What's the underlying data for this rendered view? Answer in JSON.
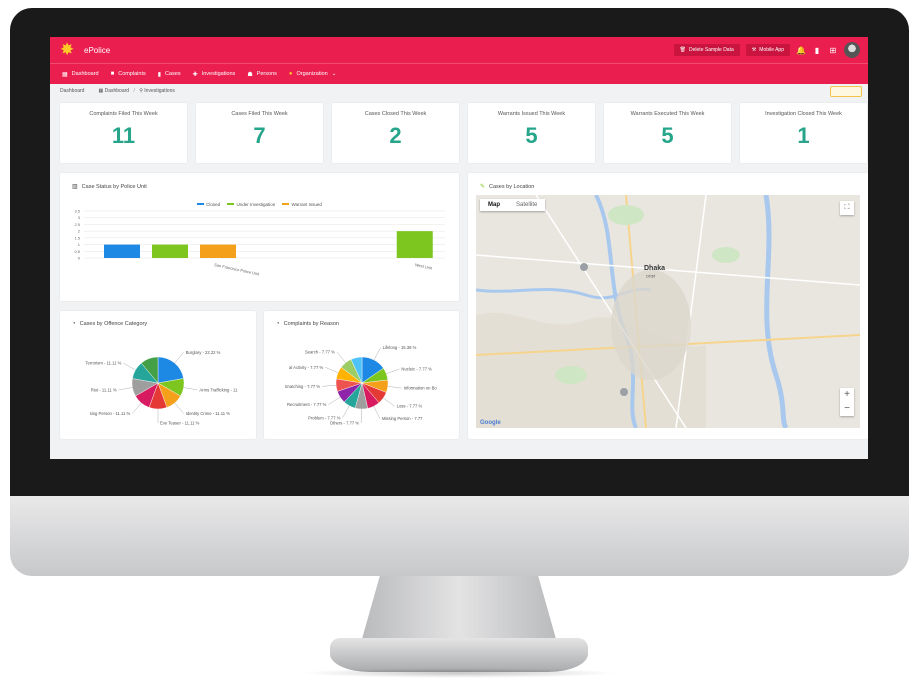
{
  "app": {
    "name": "ePolice"
  },
  "topbar": {
    "delete_sample_label": "Delete Sample Data",
    "mobile_app_label": "Mobile App"
  },
  "nav": {
    "items": [
      {
        "label": "Dashboard",
        "icon": "grid-icon"
      },
      {
        "label": "Complaints",
        "icon": "chat-icon"
      },
      {
        "label": "Cases",
        "icon": "folder-icon"
      },
      {
        "label": "Investigations",
        "icon": "wrench-icon"
      },
      {
        "label": "Persons",
        "icon": "users-icon"
      },
      {
        "label": "Organization",
        "icon": "org-icon"
      }
    ]
  },
  "breadcrumb": {
    "current": "Dashboard",
    "items": [
      "Dashboard",
      "Investigations"
    ]
  },
  "stats": [
    {
      "title": "Complaints Filed This Week",
      "value": "11"
    },
    {
      "title": "Cases Filed This Week",
      "value": "7"
    },
    {
      "title": "Cases Closed This Week",
      "value": "2"
    },
    {
      "title": "Warrants Issued This Week",
      "value": "5"
    },
    {
      "title": "Warrants Executed This Week",
      "value": "5"
    },
    {
      "title": "Investigation Closed This Week",
      "value": "1"
    }
  ],
  "panels": {
    "case_status_title": "Case Status by Police Unit",
    "location_title": "Cases by Location",
    "offence_title": "Cases by Offence Category",
    "complaints_title": "Complaints by Reason"
  },
  "map": {
    "tab_map": "Map",
    "tab_satellite": "Satellite",
    "city": "Dhaka",
    "city_local": "ঢাকা",
    "google": "Google"
  },
  "colors": {
    "brand": "#ea1e4f",
    "stat_value": "#27a58b",
    "closed": "#1e88e5",
    "under_investigation": "#7cc61f",
    "warrant_issued": "#f5a01b"
  },
  "chart_data": [
    {
      "type": "bar",
      "title": "Case Status by Police Unit",
      "categories": [
        "San Francisco Police Unit",
        "West Unit"
      ],
      "series": [
        {
          "name": "Closed",
          "values": [
            1,
            0
          ]
        },
        {
          "name": "Under Investigation",
          "values": [
            1,
            2
          ]
        },
        {
          "name": "Warrant Issued",
          "values": [
            1,
            0
          ]
        }
      ],
      "y_ticks": [
        "3.5",
        "3",
        "2.5",
        "2",
        "1.5",
        "1",
        "0.5",
        "0"
      ],
      "ylim": [
        0,
        3.5
      ],
      "legend": "top"
    },
    {
      "type": "pie",
      "title": "Cases by Offence Category",
      "slices": [
        {
          "label": "Burglary",
          "value": 22.22,
          "text": "Burglary - 22.22 %",
          "color": "#1e88e5"
        },
        {
          "label": "Arms Trafficking",
          "value": 11.11,
          "text": "Arms Trafficking - 11",
          "color": "#7cc61f"
        },
        {
          "label": "Identity Crime",
          "value": 11.11,
          "text": "Identity Crime - 11.11 %",
          "color": "#f5a01b"
        },
        {
          "label": "Eve Teaser",
          "value": 11.11,
          "text": "Eve Teaser - 11.11 %",
          "color": "#e53935"
        },
        {
          "label": "Missing Person",
          "value": 11.11,
          "text": "sing Person - 11.11 %",
          "color": "#d81b60"
        },
        {
          "label": "Riot",
          "value": 11.11,
          "text": "Riot - 11.11 %",
          "color": "#9e9e9e"
        },
        {
          "label": "Terrorism",
          "value": 11.11,
          "text": "Terrorism - 11.11 %",
          "color": "#26a69a"
        },
        {
          "label": "Other",
          "value": 11.12,
          "text": "",
          "color": "#43a047"
        }
      ]
    },
    {
      "type": "pie",
      "title": "Complaints by Reason",
      "slices": [
        {
          "label": "Lifelong",
          "value": 15.38,
          "text": "Lifelong - 15.38 %",
          "color": "#1e88e5"
        },
        {
          "label": "Nucleic",
          "value": 7.77,
          "text": "Nucleic - 7.77 %",
          "color": "#7cc61f"
        },
        {
          "label": "Information on Bo",
          "value": 7.77,
          "text": "Information on Bo",
          "color": "#f5a01b"
        },
        {
          "label": "Loss",
          "value": 7.77,
          "text": "Loss - 7.77 %",
          "color": "#e53935"
        },
        {
          "label": "Missing Person",
          "value": 7.77,
          "text": "Missing Person - 7.77",
          "color": "#d81b60"
        },
        {
          "label": "Others",
          "value": 7.77,
          "text": "Others - 7.77 %",
          "color": "#9e9e9e"
        },
        {
          "label": "Problem",
          "value": 7.77,
          "text": "Problem - 7.77 %",
          "color": "#26a69a"
        },
        {
          "label": "Recruitment",
          "value": 7.77,
          "text": "Recruitment - 7.77 %",
          "color": "#8e24aa"
        },
        {
          "label": "Snatching",
          "value": 7.77,
          "text": "Snatching - 7.77 %",
          "color": "#ef5350"
        },
        {
          "label": "al Activity",
          "value": 7.77,
          "text": "al Activity - 7.77 %",
          "color": "#ffb300"
        },
        {
          "label": "Search",
          "value": 7.77,
          "text": "Search - 7.77 %",
          "color": "#9ccc65"
        },
        {
          "label": "Other",
          "value": 6.92,
          "text": "",
          "color": "#4fc3f7"
        }
      ]
    }
  ]
}
